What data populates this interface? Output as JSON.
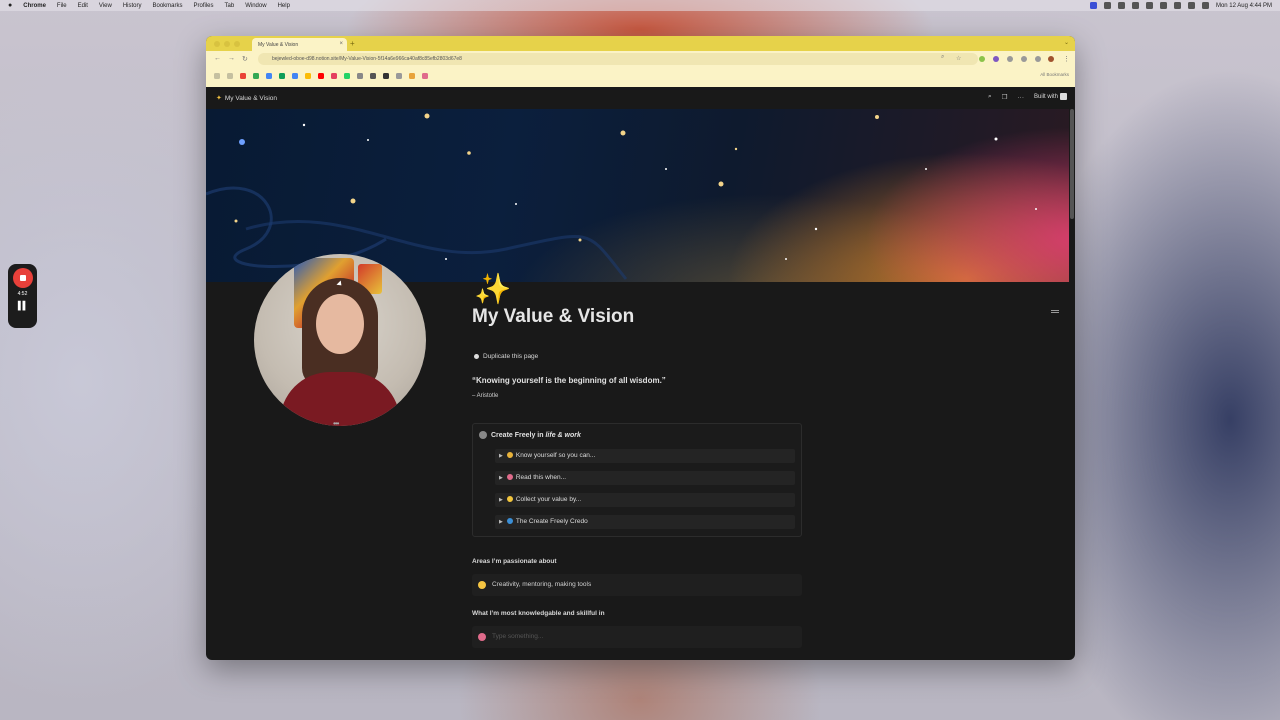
{
  "os_menubar": {
    "app": "Chrome",
    "items": [
      "File",
      "Edit",
      "View",
      "History",
      "Bookmarks",
      "Profiles",
      "Tab",
      "Window",
      "Help"
    ],
    "clock": "Mon 12 Aug 4:44 PM"
  },
  "recorder": {
    "time": "4:52"
  },
  "browser": {
    "tab_title": "My Value & Vision",
    "url": "bejewled-oboe-d98.notion.site/My-Value-Vision-5f14a6e966ca40af8c85efb2803d67e8",
    "all_bookmarks": "All Bookmarks"
  },
  "notion": {
    "top_title": "My Value & Vision",
    "built_with": "Built with",
    "page_title": "My Value & Vision",
    "duplicate_label": "Duplicate this page",
    "quote": "“Knowing yourself is the beginning of all wisdom.”",
    "quote_author": "– Aristotle",
    "callout": {
      "title_prefix": "Create Freely in ",
      "title_italic": "life & work",
      "toggles": [
        {
          "label": "Know yourself so you can...",
          "emoji_color": "#e8b23a"
        },
        {
          "label": "Read this when...",
          "emoji_color": "#e06b8b"
        },
        {
          "label": "Collect your value by...",
          "emoji_color": "#f2c53d"
        },
        {
          "label": "The Create Freely Credo",
          "emoji_color": "#3b8fd6"
        }
      ]
    },
    "sections": [
      {
        "label": "Areas I’m passionate about",
        "answer": "Creativity, mentoring, making tools",
        "icon_color": "#f5c542",
        "placeholder": false
      },
      {
        "label": "What I’m most knowledgable and skillful in",
        "answer": "Type something...",
        "icon_color": "#e06b8b",
        "placeholder": true
      }
    ]
  }
}
